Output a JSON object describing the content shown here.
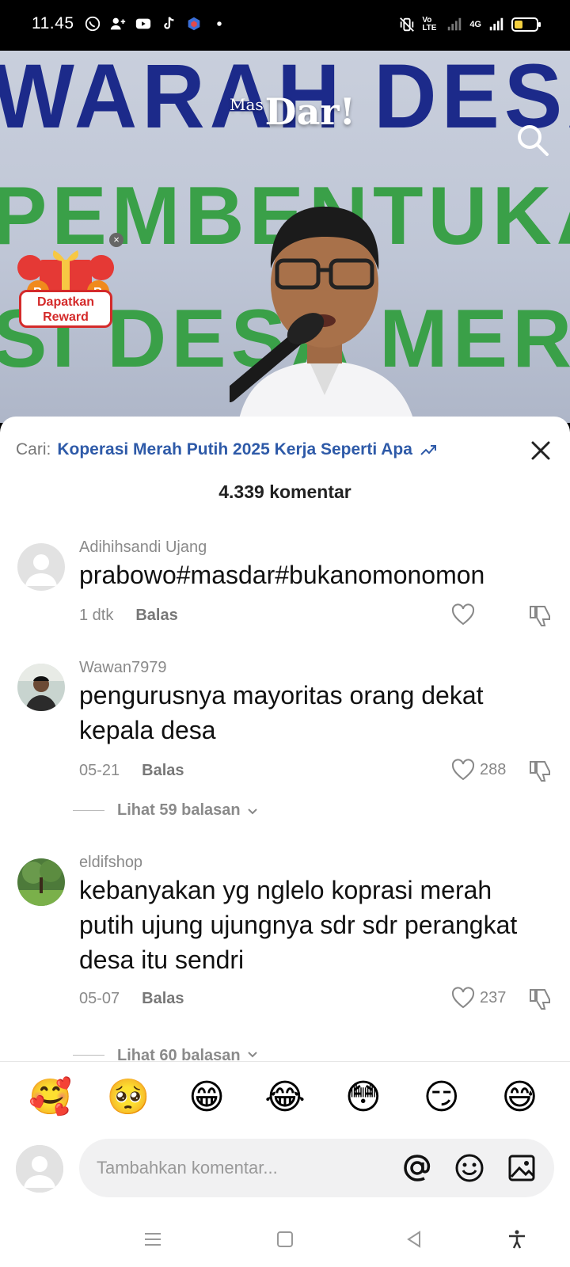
{
  "status_bar": {
    "time": "11.45",
    "network_label": "4G",
    "volte_label": "Vo LTE"
  },
  "video": {
    "banner_lines": [
      "WARAH DESA K",
      "PEMBENTUKAN",
      "SI DESA MERA"
    ],
    "brand_small": "Mas",
    "brand_logo": "Dar!",
    "reward_label_line1": "Dapatkan",
    "reward_label_line2": "Reward"
  },
  "sheet": {
    "search_prefix": "Cari:",
    "search_term": "Koperasi Merah Putih 2025 Kerja Seperti Apa",
    "comment_count": "4.339 komentar"
  },
  "comments": [
    {
      "username": "Adihihsandi Ujang",
      "text": "prabowo#masdar#bukanomonomon",
      "time": "1 dtk",
      "reply_label": "Balas",
      "likes": ""
    },
    {
      "username": "Wawan7979",
      "text": "pengurusnya mayoritas orang dekat kepala desa",
      "time": "05-21",
      "reply_label": "Balas",
      "likes": "288",
      "view_replies": "Lihat 59 balasan"
    },
    {
      "username": "eldifshop",
      "text": "kebanyakan yg nglelo koprasi merah putih ujung ujungnya sdr sdr perangkat desa itu sendri",
      "time": "05-07",
      "reply_label": "Balas",
      "likes": "237",
      "view_replies": "Lihat 60 balasan"
    }
  ],
  "emoji_bar": [
    "🥰",
    "🥺",
    "😁",
    "😂",
    "😳",
    "😏",
    "😅"
  ],
  "input": {
    "placeholder": "Tambahkan komentar..."
  },
  "colors": {
    "accent_link": "#2e5aa8",
    "banner_blue": "#1c2a8a",
    "banner_green": "#3aa048",
    "reward_red": "#d42a2a"
  }
}
